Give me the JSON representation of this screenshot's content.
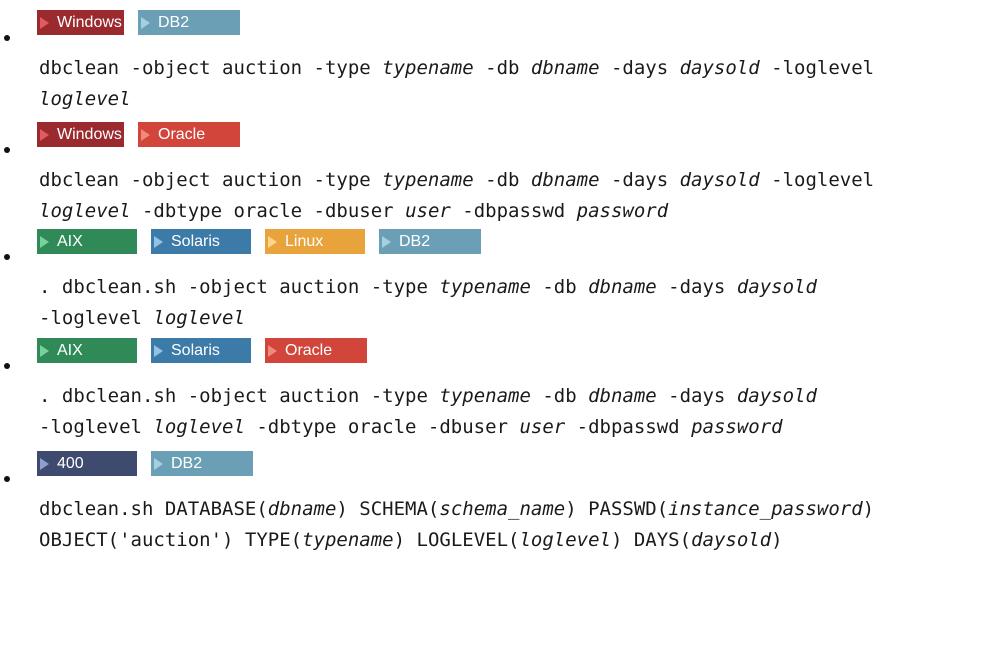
{
  "entries": [
    {
      "badges": [
        {
          "label": "Windows",
          "color": "#9b2a2f",
          "arrow": "#e05a5f",
          "width": 87
        },
        {
          "label": "DB2",
          "color": "#6a9fb5",
          "arrow": "#a6d0e0",
          "width": 102
        }
      ],
      "lines": [
        [
          {
            "t": "dbclean -object auction -type "
          },
          {
            "t": "typename",
            "i": true
          },
          {
            "t": " -db "
          },
          {
            "t": "dbname",
            "i": true
          },
          {
            "t": " -days "
          },
          {
            "t": "daysold",
            "i": true
          },
          {
            "t": " -loglevel"
          }
        ],
        [
          {
            "t": "loglevel",
            "i": true
          }
        ]
      ]
    },
    {
      "badges": [
        {
          "label": "Windows",
          "color": "#9b2a2f",
          "arrow": "#e05a5f",
          "width": 87
        },
        {
          "label": "Oracle",
          "color": "#d1453b",
          "arrow": "#f08a7a",
          "width": 102
        }
      ],
      "lines": [
        [
          {
            "t": "dbclean -object auction -type "
          },
          {
            "t": "typename",
            "i": true
          },
          {
            "t": " -db "
          },
          {
            "t": "dbname",
            "i": true
          },
          {
            "t": " -days "
          },
          {
            "t": "daysold",
            "i": true
          },
          {
            "t": " -loglevel"
          }
        ],
        [
          {
            "t": "loglevel",
            "i": true
          },
          {
            "t": " -dbtype oracle -dbuser "
          },
          {
            "t": "user",
            "i": true
          },
          {
            "t": " -dbpasswd "
          },
          {
            "t": "password",
            "i": true
          }
        ]
      ]
    },
    {
      "badges": [
        {
          "label": "AIX",
          "color": "#2f8a57",
          "arrow": "#78d19a",
          "width": 100
        },
        {
          "label": "Solaris",
          "color": "#3c7aa8",
          "arrow": "#93c2e6",
          "width": 100
        },
        {
          "label": "Linux",
          "color": "#e8a33c",
          "arrow": "#ffd48a",
          "width": 100
        },
        {
          "label": "DB2",
          "color": "#6a9fb5",
          "arrow": "#a6d0e0",
          "width": 102
        }
      ],
      "lines": [
        [
          {
            "t": ". dbclean.sh -object auction -type "
          },
          {
            "t": "typename",
            "i": true
          },
          {
            "t": " -db "
          },
          {
            "t": "dbname",
            "i": true
          },
          {
            "t": " -days "
          },
          {
            "t": "daysold",
            "i": true
          }
        ],
        [
          {
            "t": "-loglevel "
          },
          {
            "t": "loglevel",
            "i": true
          }
        ]
      ]
    },
    {
      "badges": [
        {
          "label": "AIX",
          "color": "#2f8a57",
          "arrow": "#78d19a",
          "width": 100
        },
        {
          "label": "Solaris",
          "color": "#3c7aa8",
          "arrow": "#93c2e6",
          "width": 100
        },
        {
          "label": "Oracle",
          "color": "#d1453b",
          "arrow": "#f08a7a",
          "width": 102
        }
      ],
      "lines": [
        [
          {
            "t": ". dbclean.sh -object auction -type "
          },
          {
            "t": "typename",
            "i": true
          },
          {
            "t": " -db "
          },
          {
            "t": "dbname",
            "i": true
          },
          {
            "t": " -days "
          },
          {
            "t": "daysold",
            "i": true
          }
        ],
        [
          {
            "t": "-loglevel "
          },
          {
            "t": "loglevel",
            "i": true
          },
          {
            "t": " -dbtype oracle -dbuser "
          },
          {
            "t": "user",
            "i": true
          },
          {
            "t": " -dbpasswd "
          },
          {
            "t": "password",
            "i": true
          }
        ]
      ]
    },
    {
      "badges": [
        {
          "label": "400",
          "color": "#3e4a6e",
          "arrow": "#8fa0d0",
          "width": 100
        },
        {
          "label": "DB2",
          "color": "#6a9fb5",
          "arrow": "#a6d0e0",
          "width": 102
        }
      ],
      "lines": [
        [
          {
            "t": "dbclean.sh DATABASE("
          },
          {
            "t": "dbname",
            "i": true
          },
          {
            "t": ") SCHEMA("
          },
          {
            "t": "schema_name",
            "i": true
          },
          {
            "t": ") PASSWD("
          },
          {
            "t": "instance_password",
            "i": true
          },
          {
            "t": ")"
          }
        ],
        [
          {
            "t": "OBJECT('auction') TYPE("
          },
          {
            "t": "typename",
            "i": true
          },
          {
            "t": ") LOGLEVEL("
          },
          {
            "t": "loglevel",
            "i": true
          },
          {
            "t": ") DAYS("
          },
          {
            "t": "daysold",
            "i": true
          },
          {
            "t": ")"
          }
        ]
      ]
    }
  ]
}
